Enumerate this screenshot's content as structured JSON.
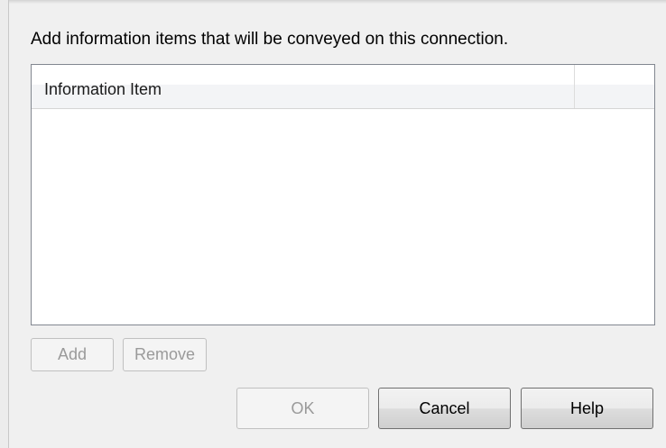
{
  "dialog": {
    "instruction": "Add information items that will be conveyed on this connection.",
    "list": {
      "columns": [
        "Information Item",
        ""
      ],
      "rows": []
    },
    "buttons": {
      "add": "Add",
      "remove": "Remove",
      "ok": "OK",
      "cancel": "Cancel",
      "help": "Help"
    },
    "states": {
      "add_enabled": false,
      "remove_enabled": false,
      "ok_enabled": false,
      "cancel_enabled": true,
      "help_enabled": true
    }
  }
}
